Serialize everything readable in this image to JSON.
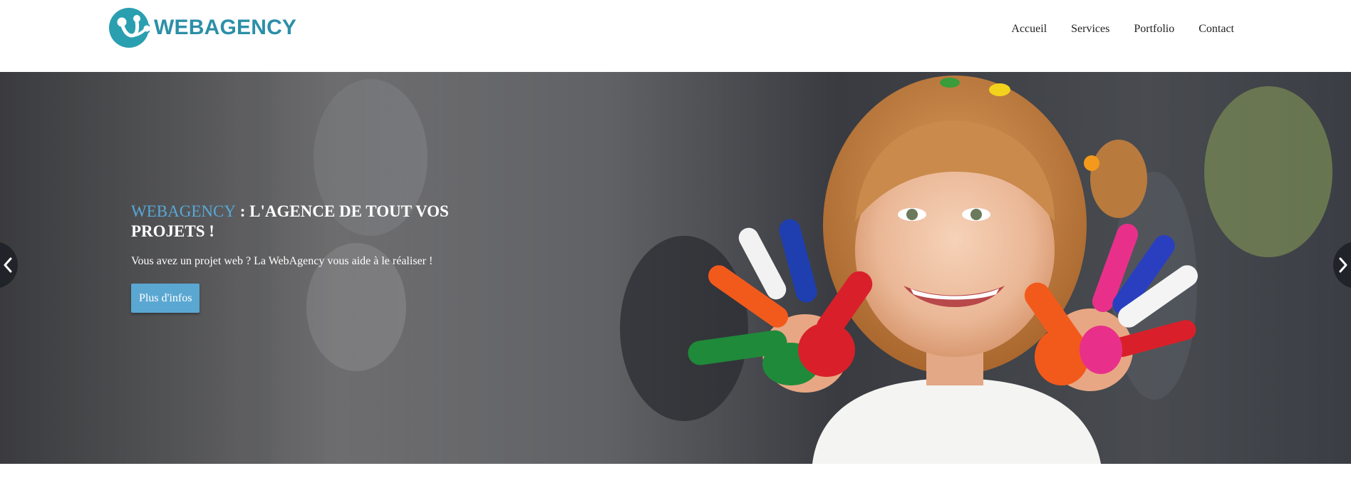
{
  "brand": {
    "name": "WEBAGENCY",
    "color": "#2c8fa8"
  },
  "nav": {
    "items": [
      {
        "label": "Accueil"
      },
      {
        "label": "Services"
      },
      {
        "label": "Portfolio"
      },
      {
        "label": "Contact"
      }
    ]
  },
  "hero": {
    "title_brand": "WEBAGENCY",
    "title_rest": " : L'AGENCE DE TOUT VOS PROJETS !",
    "subtitle": "Vous avez un projet web ? La WebAgency vous aide à le réaliser !",
    "button_label": "Plus d'infos",
    "accent_color": "#5aa7d2"
  },
  "carousel": {
    "prev_icon": "chevron-left-icon",
    "next_icon": "chevron-right-icon"
  }
}
